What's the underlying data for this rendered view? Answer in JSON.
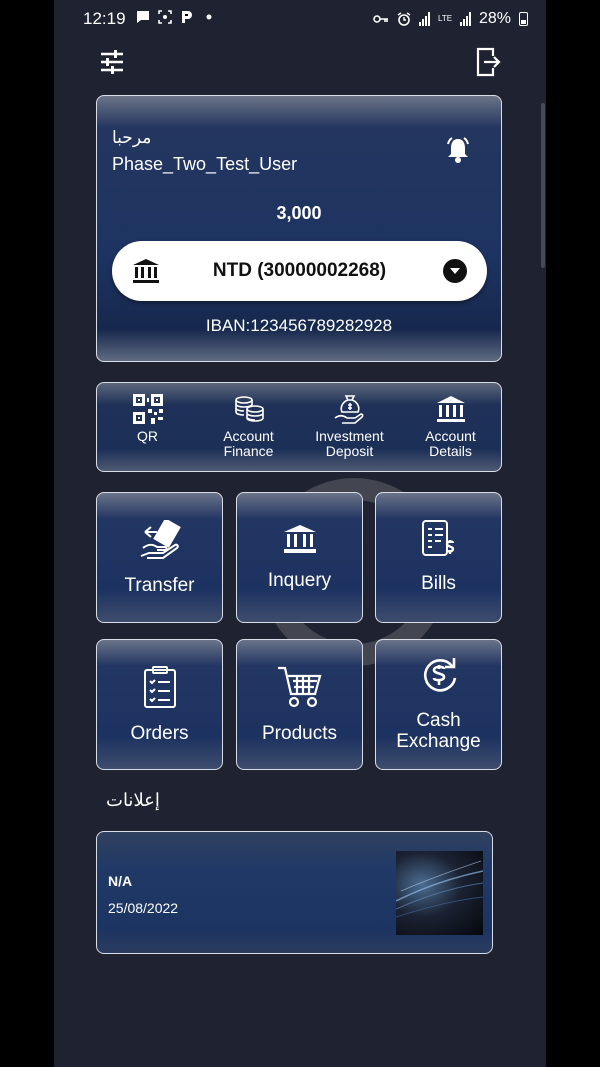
{
  "status_bar": {
    "time": "12:19",
    "battery": "28%",
    "network": "LTE"
  },
  "card": {
    "greeting": "مرحبا",
    "username": "Phase_Two_Test_User",
    "balance": "3,000",
    "account": "NTD (30000002268)",
    "iban": "IBAN:123456789282928"
  },
  "quick_actions": [
    {
      "label": "QR",
      "icon": "qr-code-icon"
    },
    {
      "label": "Account Finance",
      "icon": "coins-stack-icon"
    },
    {
      "label": "Investment Deposit",
      "icon": "money-bag-hand-icon"
    },
    {
      "label": "Account Details",
      "icon": "bank-icon"
    }
  ],
  "tiles": [
    {
      "label": "Transfer",
      "icon": "money-transfer-icon"
    },
    {
      "label": "Inquery",
      "icon": "bank-icon"
    },
    {
      "label": "Bills",
      "icon": "bill-dollar-icon"
    },
    {
      "label": "Orders",
      "icon": "clipboard-checklist-icon"
    },
    {
      "label": "Products",
      "icon": "shopping-cart-icon"
    },
    {
      "label": "Cash Exchange",
      "icon": "currency-exchange-icon"
    }
  ],
  "ads": {
    "title": "إعلانات",
    "items": [
      {
        "name": "N/A",
        "date": "25/08/2022"
      }
    ]
  },
  "colors": {
    "background": "#1f2230",
    "card_blue": "#1d3361",
    "border": "#d9dde6"
  }
}
